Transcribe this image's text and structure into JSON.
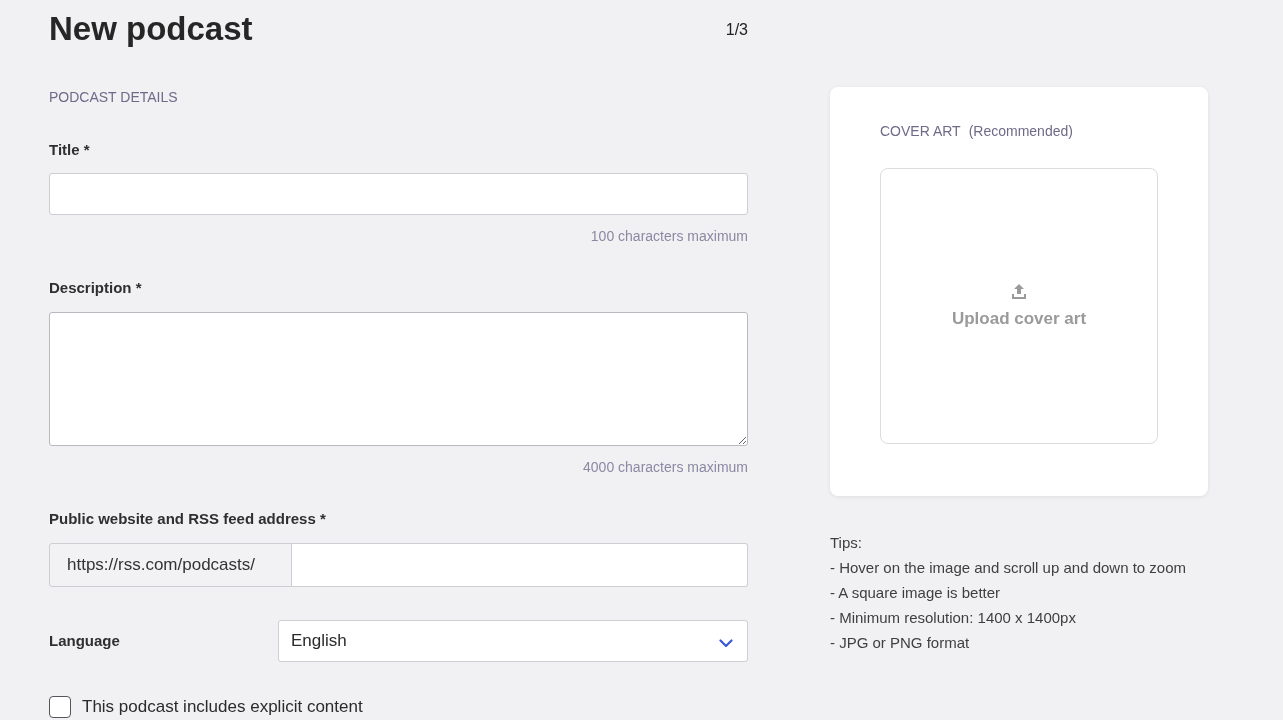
{
  "header": {
    "title": "New podcast",
    "step": "1/3"
  },
  "section_title": "PODCAST DETAILS",
  "fields": [
    {
      "kind": "text",
      "label": "Title *",
      "hint": "100 characters maximum"
    },
    {
      "kind": "textarea",
      "label": "Description *",
      "hint": "4000 characters maximum"
    },
    {
      "kind": "url",
      "label": "Public website and RSS feed address *",
      "prefix": "https://rss.com/podcasts/"
    },
    {
      "kind": "select",
      "label": "Language",
      "value": "English"
    }
  ],
  "explicit_checkbox": {
    "label": "This podcast includes explicit content",
    "checked": false
  },
  "cover_art": {
    "title": "COVER ART",
    "note": "(Recommended)",
    "upload_label": "Upload cover art"
  },
  "tips": {
    "heading": "Tips:",
    "items": [
      "- Hover on the image and scroll up and down to zoom",
      "- A square image is better",
      "- Minimum resolution: 1400 x 1400px",
      "- JPG or PNG format"
    ]
  }
}
